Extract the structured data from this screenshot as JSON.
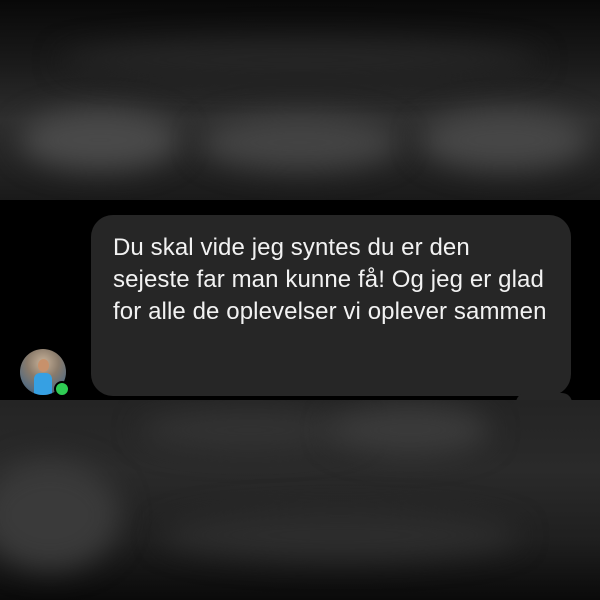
{
  "message": {
    "text": "Du skal vide jeg syntes du er den sejeste far man kunne få! Og jeg er glad for alle de oplevelser vi oplever sammen"
  },
  "sender": {
    "online": true
  },
  "colors": {
    "background": "#000000",
    "bubble": "#262626",
    "message_text": "#f2f2f2",
    "online_indicator": "#2fcc54"
  }
}
